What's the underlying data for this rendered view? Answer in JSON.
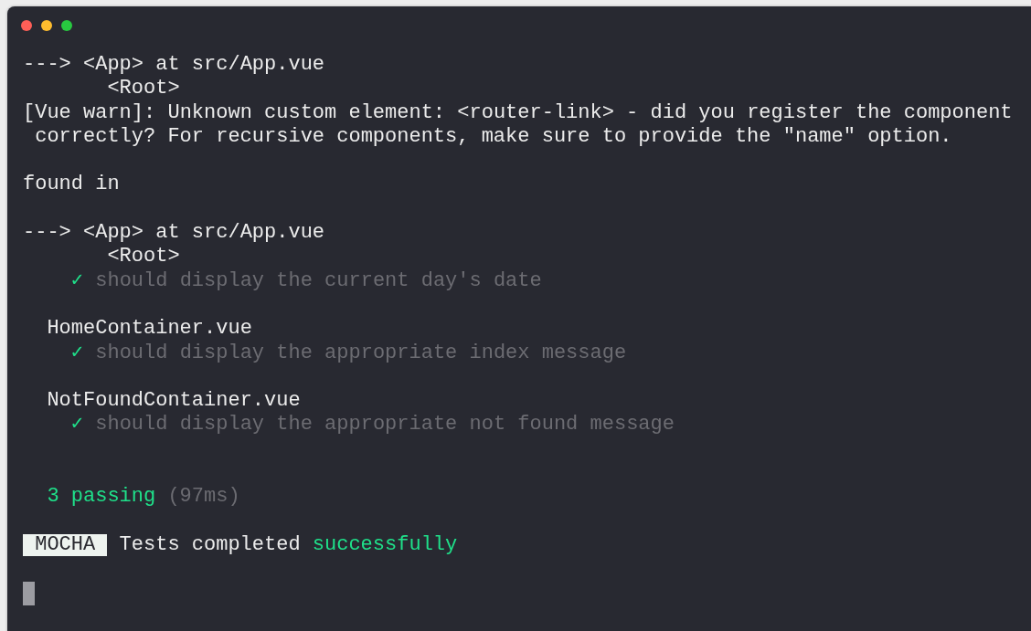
{
  "lines": [
    {
      "kind": "text",
      "text": "---> <App> at src/App.vue"
    },
    {
      "kind": "nested",
      "text": "<Root>"
    },
    {
      "kind": "text",
      "text": "[Vue warn]: Unknown custom element: <router-link> - did you register the component"
    },
    {
      "kind": "cont",
      "text": "correctly? For recursive components, make sure to provide the \"name\" option."
    },
    {
      "kind": "blank"
    },
    {
      "kind": "text",
      "text": "found in"
    },
    {
      "kind": "blank"
    },
    {
      "kind": "text",
      "text": "---> <App> at src/App.vue"
    },
    {
      "kind": "nested",
      "text": "<Root>"
    },
    {
      "kind": "test",
      "mark": "✓",
      "text": "should display the current day's date"
    },
    {
      "kind": "blank"
    },
    {
      "kind": "suite",
      "text": "HomeContainer.vue"
    },
    {
      "kind": "test",
      "mark": "✓",
      "text": "should display the appropriate index message"
    },
    {
      "kind": "blank"
    },
    {
      "kind": "suite",
      "text": "NotFoundContainer.vue"
    },
    {
      "kind": "test",
      "mark": "✓",
      "text": "should display the appropriate not found message"
    },
    {
      "kind": "blank"
    },
    {
      "kind": "blank"
    },
    {
      "kind": "summary",
      "count": "3 passing",
      "time": "(97ms)"
    },
    {
      "kind": "blank"
    },
    {
      "kind": "badge",
      "badge": "MOCHA",
      "text": "Tests completed",
      "status": "successfully"
    },
    {
      "kind": "blank"
    },
    {
      "kind": "cursor"
    }
  ]
}
